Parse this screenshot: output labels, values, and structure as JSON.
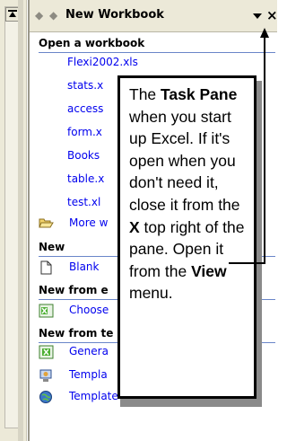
{
  "pane": {
    "title": "New Workbook",
    "back_icon": "left-arrow-icon",
    "forward_icon": "right-arrow-icon",
    "menu_icon": "dropdown-icon",
    "close_glyph": "×"
  },
  "sections": {
    "open": "Open a workbook",
    "new": "New",
    "from_existing": "New from e",
    "from_template": "New from te"
  },
  "open_links": [
    "Flexi2002.xls",
    "stats.x",
    "access",
    "form.x",
    "Books",
    "table.x",
    "test.xl"
  ],
  "more": "More w",
  "blank": "Blank",
  "choose": "Choose",
  "general": "Genera",
  "templates_1": "Templa",
  "templates_2": "Template",
  "callout": {
    "text_1": "The ",
    "task_pane": "Task Pane",
    "text_2": " when you start up Excel. If it's open when you don't need it, close it from the ",
    "x": "X",
    "text_3": " top right of the pane. Open it from the ",
    "view": "View",
    "text_4": " menu."
  }
}
